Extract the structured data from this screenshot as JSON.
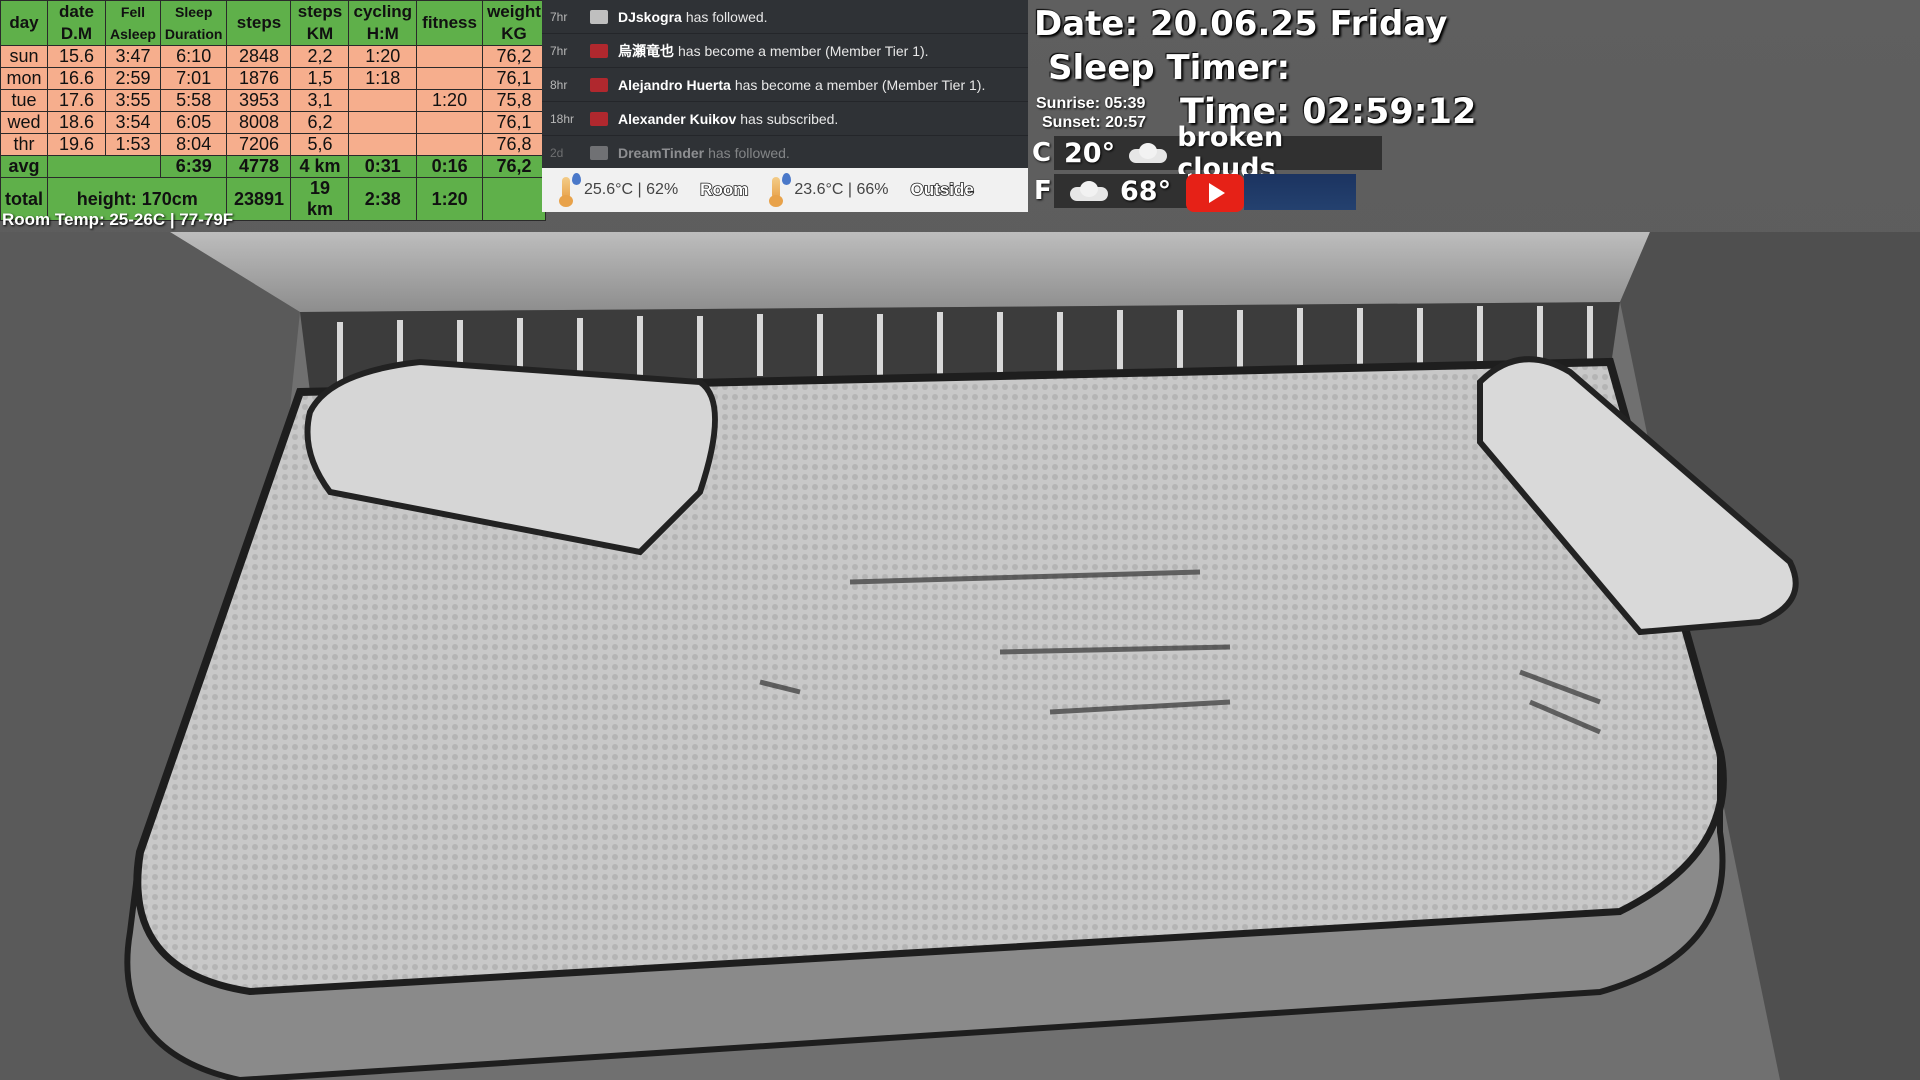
{
  "stats": {
    "headers": [
      {
        "top": "day",
        "bottom": ""
      },
      {
        "top": "date",
        "bottom": "D.M"
      },
      {
        "top": "Fell",
        "bottom": "Asleep"
      },
      {
        "top": "Sleep",
        "bottom": "Duration"
      },
      {
        "top": "steps",
        "bottom": ""
      },
      {
        "top": "steps",
        "bottom": "KM"
      },
      {
        "top": "cycling",
        "bottom": "H:M"
      },
      {
        "top": "fitness",
        "bottom": ""
      },
      {
        "top": "weight",
        "bottom": "KG"
      }
    ],
    "rows": [
      [
        "sun",
        "15.6",
        "3:47",
        "6:10",
        "2848",
        "2,2",
        "1:20",
        "",
        "76,2"
      ],
      [
        "mon",
        "16.6",
        "2:59",
        "7:01",
        "1876",
        "1,5",
        "1:18",
        "",
        "76,1"
      ],
      [
        "tue",
        "17.6",
        "3:55",
        "5:58",
        "3953",
        "3,1",
        "",
        "1:20",
        "75,8"
      ],
      [
        "wed",
        "18.6",
        "3:54",
        "6:05",
        "8008",
        "6,2",
        "",
        "",
        "76,1"
      ],
      [
        "thr",
        "19.6",
        "1:53",
        "8:04",
        "7206",
        "5,6",
        "",
        "",
        "76,8"
      ]
    ],
    "avg": {
      "label": "avg",
      "sleep": "6:39",
      "steps": "4778",
      "km": "4 km",
      "cycling": "0:31",
      "fitness": "0:16",
      "weight": "76,2"
    },
    "total": {
      "label": "total",
      "height": "height: 170cm",
      "steps": "23891",
      "km": "19 km",
      "cycling": "2:38",
      "fitness": "1:20"
    }
  },
  "room_temp_note": "Room Temp: 25-26C | 77-79F",
  "feed": [
    {
      "ago": "7hr",
      "icon": "follow-icon",
      "user": "DJskogra",
      "text": "has followed.",
      "faded": false
    },
    {
      "ago": "7hr",
      "icon": "member-icon",
      "user": "烏瀬竜也",
      "text": "has become a member (Member Tier 1).",
      "faded": false
    },
    {
      "ago": "8hr",
      "icon": "member-icon",
      "user": "Alejandro Huerta",
      "text": "has become a member (Member Tier 1).",
      "faded": false
    },
    {
      "ago": "18hr",
      "icon": "member-icon",
      "user": "Alexander Kuikov",
      "text": "has subscribed.",
      "faded": false
    },
    {
      "ago": "2d",
      "icon": "follow-icon",
      "user": "DreamTinder",
      "text": "has followed.",
      "faded": true
    }
  ],
  "tempbar": {
    "room_reading": "25.6°C | 62%",
    "room_label": "Room",
    "outside_reading": "23.6°C | 66%",
    "outside_label": "Outside"
  },
  "info": {
    "date": "Date: 20.06.25 Friday",
    "sleep_timer": "Sleep Timer:",
    "sunrise": "Sunrise: 05:39",
    "sunset": "Sunset: 20:57",
    "time": "Time: 02:59:12",
    "unit_c": "C",
    "unit_f": "F",
    "temp_c": "20°",
    "condition": "broken clouds",
    "temp_f": "68°"
  },
  "colors": {
    "header_green": "#5fb04a",
    "row_salmon": "#f6ae8d",
    "feed_bg": "#2f3236",
    "youtube_red": "#e62117"
  }
}
